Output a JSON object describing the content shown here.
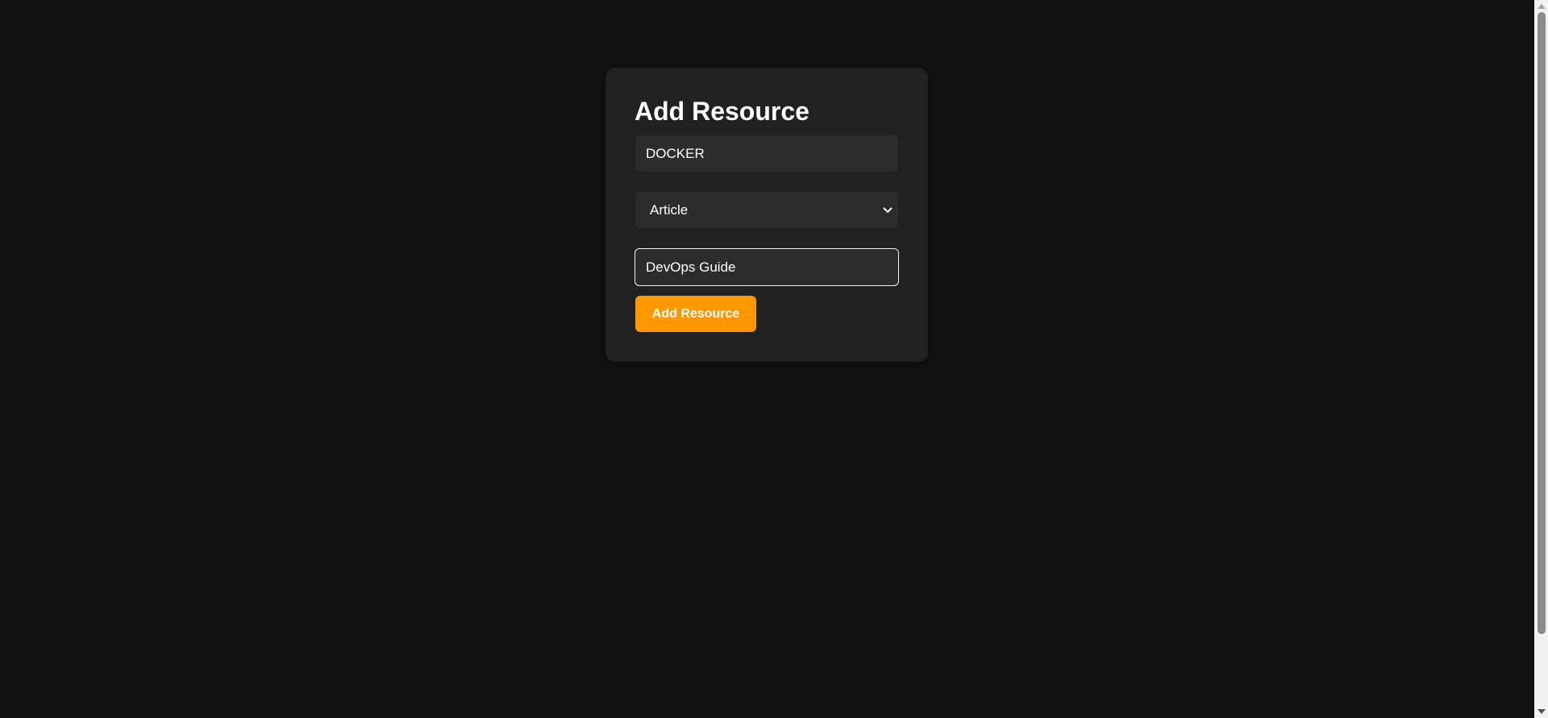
{
  "form": {
    "title": "Add Resource",
    "name_value": "DOCKER",
    "type_selected": "Article",
    "link_value": "DevOps Guide",
    "submit_label": "Add Resource"
  },
  "colors": {
    "background": "#121212",
    "card": "#212121",
    "field": "#2c2c2c",
    "accent": "#ff9800",
    "focus_border": "#f2f2f2"
  },
  "icons": {
    "select_arrow": "chevron-down-icon"
  }
}
